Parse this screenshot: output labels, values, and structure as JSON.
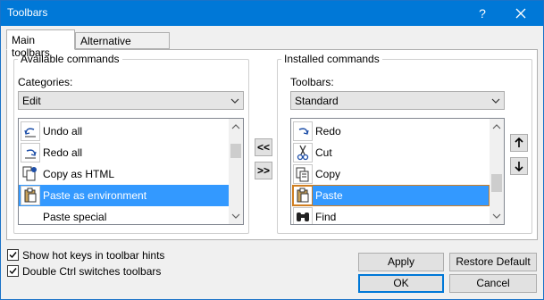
{
  "window": {
    "title": "Toolbars",
    "help_label": "?"
  },
  "tabs": [
    {
      "label": "Main toolbars",
      "active": true
    },
    {
      "label": "Alternative toolbars",
      "active": false
    }
  ],
  "available": {
    "group_label": "Available commands",
    "categories_label": "Categories:",
    "categories_value": "Edit",
    "items": [
      {
        "label": "Undo all",
        "icon": "undo-icon"
      },
      {
        "label": "Redo all",
        "icon": "redo-icon"
      },
      {
        "label": "Copy as HTML",
        "icon": "copy-html-icon"
      },
      {
        "label": "Paste as environment",
        "icon": "paste-icon",
        "selected": true
      },
      {
        "label": "Paste special",
        "icon": ""
      }
    ]
  },
  "transfer": {
    "add_label": "<<",
    "remove_label": ">>"
  },
  "installed": {
    "group_label": "Installed commands",
    "toolbars_label": "Toolbars:",
    "toolbars_value": "Standard",
    "items": [
      {
        "label": "Redo",
        "icon": "redo-icon"
      },
      {
        "label": "Cut",
        "icon": "scissors-icon"
      },
      {
        "label": "Copy",
        "icon": "copy-icon"
      },
      {
        "label": "Paste",
        "icon": "paste-icon",
        "selected": true
      },
      {
        "label": "Find",
        "icon": "binoculars-icon"
      }
    ]
  },
  "options": {
    "show_hot_keys": {
      "label": "Show hot keys in toolbar hints",
      "checked": true
    },
    "double_ctrl": {
      "label": "Double Ctrl switches toolbars",
      "checked": true
    }
  },
  "buttons": {
    "apply": "Apply",
    "restore_default": "Restore Default",
    "ok": "OK",
    "cancel": "Cancel"
  },
  "colors": {
    "titlebar": "#0078d7",
    "selection": "#3399ff",
    "selection_outline": "#d07e20"
  }
}
